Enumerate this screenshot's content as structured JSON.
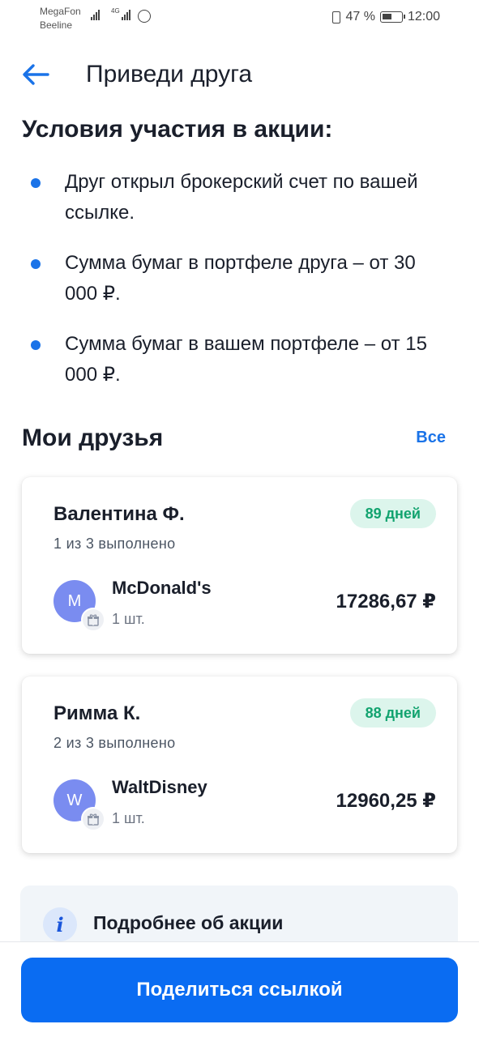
{
  "status_bar": {
    "carrier1": "MegaFon",
    "carrier2": "Beeline",
    "net_label": "4G",
    "battery": "47 %",
    "time": "12:00"
  },
  "header": {
    "title": "Приведи друга",
    "back_icon": "arrow-left-icon"
  },
  "conditions": {
    "title": "Условия участия в акции:",
    "items": [
      "Друг открыл брокерский счет по вашей ссылке.",
      "Сумма бумаг в портфеле друга – от 30 000 ₽.",
      "Сумма бумаг в вашем портфеле – от 15 000 ₽."
    ]
  },
  "friends": {
    "title": "Мои друзья",
    "see_all": "Все",
    "cards": [
      {
        "name": "Валентина Ф.",
        "progress": "1 из 3 выполнено",
        "days": "89 дней",
        "avatar_letter": "M",
        "stock": "McDonald's",
        "qty": "1 шт.",
        "amount": "17286,67 ₽"
      },
      {
        "name": "Римма К.",
        "progress": "2 из 3 выполнено",
        "days": "88 дней",
        "avatar_letter": "W",
        "stock": "WaltDisney",
        "qty": "1 шт.",
        "amount": "12960,25 ₽"
      }
    ]
  },
  "info": {
    "icon_letter": "i",
    "title": "Подробнее об акции"
  },
  "share": {
    "label": "Поделиться ссылкой"
  },
  "colors": {
    "accent": "#0a6cf2",
    "days_badge_bg": "#dcf5ec",
    "days_badge_text": "#12a36f",
    "avatar": "#7a8cf0"
  }
}
